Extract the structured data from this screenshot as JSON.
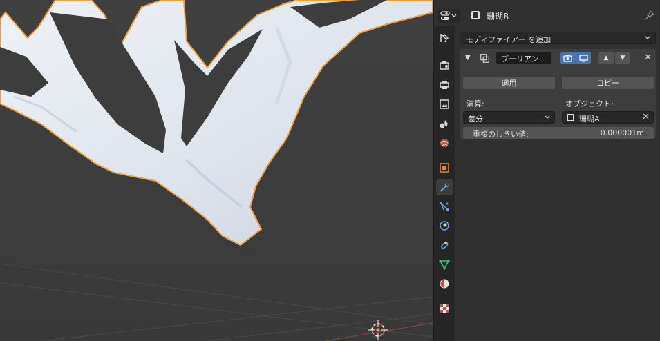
{
  "header": {
    "object_name": "珊瑚B"
  },
  "properties": {
    "add_modifier_label": "モディファイアー を追加",
    "modifier": {
      "name": "ブーリアン",
      "apply_label": "適用",
      "copy_label": "コピー",
      "operation_label": "演算:",
      "operation_value": "差分",
      "object_label": "オブジェクト:",
      "object_value": "珊瑚A",
      "threshold_label": "重複のしきい値:",
      "threshold_value": "0.000001m"
    }
  },
  "colors": {
    "accent_blue": "#4772b3",
    "selection_outline": "#f0a040",
    "mesh_fill": "#dde2ea"
  },
  "tabs": [
    {
      "name": "tool-tab",
      "icon": "tool-icon"
    },
    {
      "name": "render-tab",
      "icon": "camera-back-icon"
    },
    {
      "name": "output-tab",
      "icon": "printer-icon"
    },
    {
      "name": "view-layer-tab",
      "icon": "image-icon"
    },
    {
      "name": "scene-tab",
      "icon": "scene-icon"
    },
    {
      "name": "world-tab",
      "icon": "world-icon"
    },
    {
      "name": "object-tab",
      "icon": "object-icon"
    },
    {
      "name": "modifier-tab",
      "icon": "wrench-icon"
    },
    {
      "name": "particles-tab",
      "icon": "particles-icon"
    },
    {
      "name": "physics-tab",
      "icon": "physics-icon"
    },
    {
      "name": "constraints-tab",
      "icon": "constraint-icon"
    },
    {
      "name": "data-tab",
      "icon": "mesh-data-icon"
    },
    {
      "name": "material-tab",
      "icon": "material-icon"
    },
    {
      "name": "texture-tab",
      "icon": "texture-icon"
    }
  ]
}
